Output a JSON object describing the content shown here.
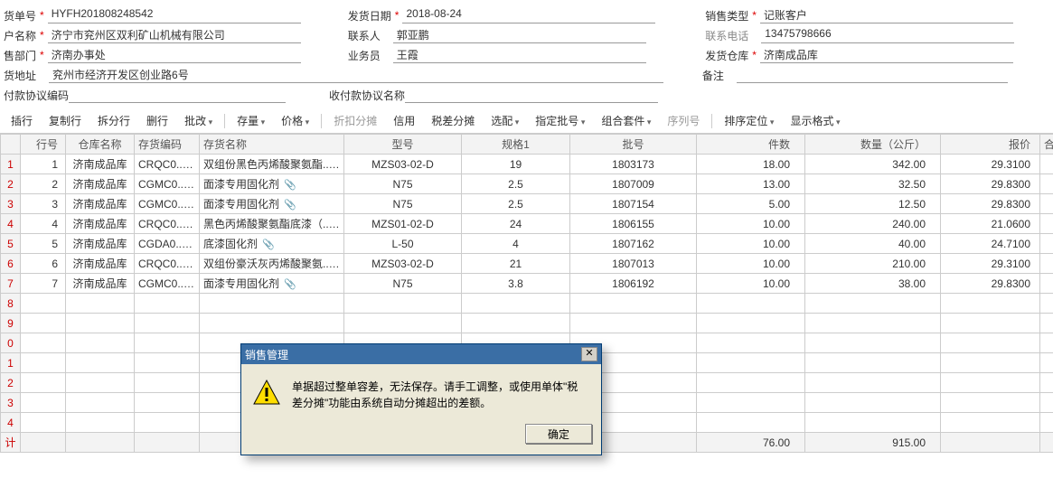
{
  "form": {
    "r1": {
      "order_no_label": "货单号",
      "order_no": "HYFH201808248542",
      "ship_date_label": "发货日期",
      "ship_date": "2018-08-24",
      "sale_type_label": "销售类型",
      "sale_type": "记账客户"
    },
    "r2": {
      "cust_label": "户名称",
      "cust": "济宁市兖州区双利矿山机械有限公司",
      "contact_label": "联系人",
      "contact": "郭亚鹏",
      "phone_label": "联系电话",
      "phone": "13475798666"
    },
    "r3": {
      "dept_label": "售部门",
      "dept": "济南办事处",
      "sales_label": "业务员",
      "sales": "王霞",
      "wh_label": "发货仓库",
      "wh": "济南成品库"
    },
    "r4": {
      "addr_label": "货地址",
      "addr": "兖州市经济开发区创业路6号",
      "remark_label": "备注",
      "remark": ""
    },
    "r5": {
      "pay_code_label": "付款协议编码",
      "pay_code": "",
      "pay_name_label": "收付款协议名称",
      "pay_name": ""
    }
  },
  "toolbar": {
    "insert": "插行",
    "copy": "复制行",
    "split": "拆分行",
    "del": "删行",
    "approve": "批改",
    "stock": "存量",
    "price": "价格",
    "discount": "折扣分摊",
    "credit": "信用",
    "tax": "税差分摊",
    "option": "选配",
    "batch": "指定批号",
    "combo": "组合套件",
    "seq": "序列号",
    "sort": "排序定位",
    "fmt": "显示格式"
  },
  "cols": {
    "seq": "行号",
    "wh": "仓库名称",
    "code": "存货编码",
    "name": "存货名称",
    "model": "型号",
    "spec": "规格1",
    "lot": "批号",
    "pcs": "件数",
    "qty": "数量（公斤）",
    "price": "报价",
    "sum": "合"
  },
  "rows": [
    {
      "n": "1",
      "seq": "1",
      "wh": "济南成品库",
      "code": "CRQC0...",
      "name": "双组份黑色丙烯酸聚氨酯...",
      "model": "MZS03-02-D",
      "spec": "19",
      "lot": "1803173",
      "pcs": "18.00",
      "qty": "342.00",
      "price": "29.3100"
    },
    {
      "n": "2",
      "seq": "2",
      "wh": "济南成品库",
      "code": "CGMC0...",
      "name": "面漆专用固化剂",
      "model": "N75",
      "spec": "2.5",
      "lot": "1807009",
      "pcs": "13.00",
      "qty": "32.50",
      "price": "29.8300"
    },
    {
      "n": "3",
      "seq": "3",
      "wh": "济南成品库",
      "code": "CGMC0...",
      "name": "面漆专用固化剂",
      "model": "N75",
      "spec": "2.5",
      "lot": "1807154",
      "pcs": "5.00",
      "qty": "12.50",
      "price": "29.8300"
    },
    {
      "n": "4",
      "seq": "4",
      "wh": "济南成品库",
      "code": "CRQC0...",
      "name": "黑色丙烯酸聚氨酯底漆（...",
      "model": "MZS01-02-D",
      "spec": "24",
      "lot": "1806155",
      "pcs": "10.00",
      "qty": "240.00",
      "price": "21.0600"
    },
    {
      "n": "5",
      "seq": "5",
      "wh": "济南成品库",
      "code": "CGDA0...",
      "name": "底漆固化剂",
      "model": "L-50",
      "spec": "4",
      "lot": "1807162",
      "pcs": "10.00",
      "qty": "40.00",
      "price": "24.7100"
    },
    {
      "n": "6",
      "seq": "6",
      "wh": "济南成品库",
      "code": "CRQC0...",
      "name": "双组份豪沃灰丙烯酸聚氨...",
      "model": "MZS03-02-D",
      "spec": "21",
      "lot": "1807013",
      "pcs": "10.00",
      "qty": "210.00",
      "price": "29.3100"
    },
    {
      "n": "7",
      "seq": "7",
      "wh": "济南成品库",
      "code": "CGMC0...",
      "name": "面漆专用固化剂",
      "model": "N75",
      "spec": "3.8",
      "lot": "1806192",
      "pcs": "10.00",
      "qty": "38.00",
      "price": "29.8300"
    }
  ],
  "empties": [
    "8",
    "9",
    "0",
    "1",
    "2",
    "3",
    "4"
  ],
  "footer": {
    "label": "计",
    "pcs": "76.00",
    "qty": "915.00"
  },
  "dialog": {
    "title": "销售管理",
    "msg1": "单据超过整单容差，无法保存。请手工调整，或使用单体\"税",
    "msg2": "差分摊\"功能由系统自动分摊超出的差额。",
    "ok": "确定"
  }
}
